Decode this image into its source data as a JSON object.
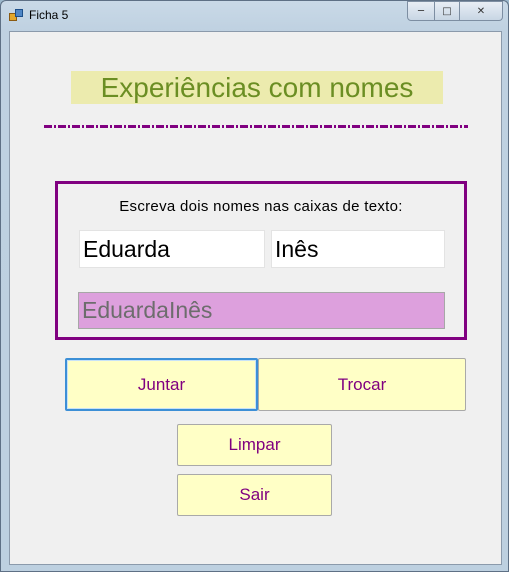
{
  "window": {
    "title": "Ficha 5",
    "icons": {
      "app": "form-icon",
      "minimize": "minimize-icon",
      "maximize": "maximize-icon",
      "close": "close-icon"
    }
  },
  "heading": "Experiências com nomes",
  "group": {
    "instruction": "Escreva dois nomes nas caixas de texto:",
    "name1_value": "Eduarda",
    "name2_value": "Inês",
    "result_value": "EduardaInês"
  },
  "buttons": {
    "join": "Juntar",
    "swap": "Trocar",
    "clear": "Limpar",
    "exit": "Sair"
  },
  "colors": {
    "heading_text": "#6b8e23",
    "heading_bg": "#ecebae",
    "accent": "#800080",
    "result_bg": "#dda0dd",
    "button_bg": "#ffffc6"
  }
}
